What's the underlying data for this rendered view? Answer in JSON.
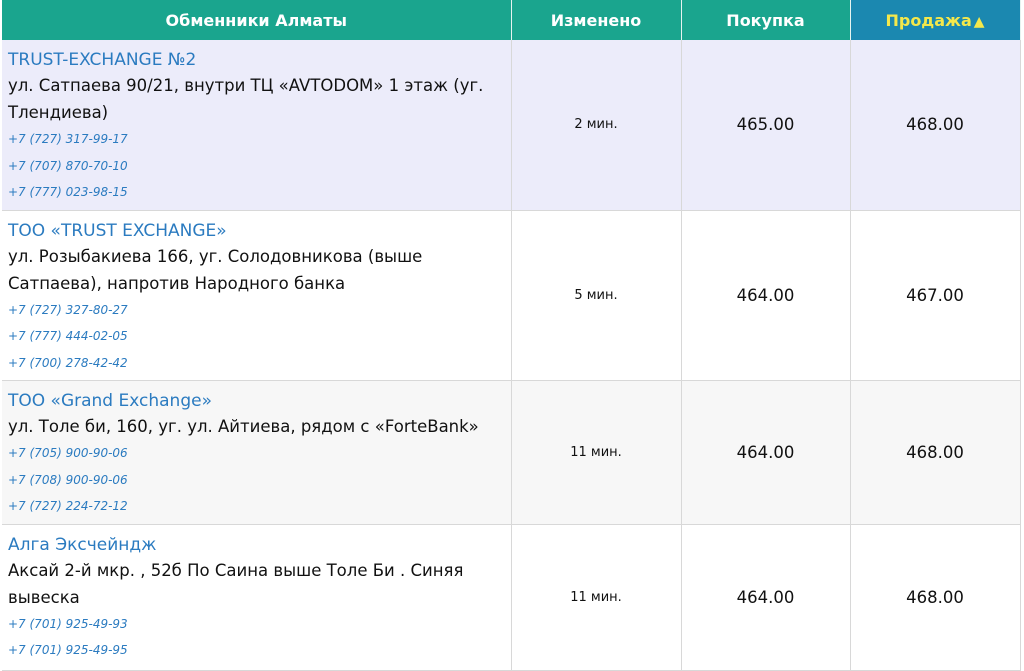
{
  "header": {
    "col_name": "Обменники Алматы",
    "col_changed": "Изменено",
    "col_buy": "Покупка",
    "col_sell": "Продажа",
    "sort_indicator": "▲"
  },
  "colors": {
    "header_bg": "#1aa58e",
    "sorted_header_bg": "#1b88b0",
    "sorted_header_text": "#f4e84b",
    "link": "#2b7bc0",
    "highlight_row": "#ececfa"
  },
  "rows": [
    {
      "name": "TRUST-EXCHANGE №2",
      "address": "ул. Сатпаева 90/21, внутри ТЦ «AVTODOM» 1 этаж (уг. Тлендиева)",
      "phones": [
        "+7 (727) 317-99-17",
        "+7 (707) 870-70-10",
        "+7 (777) 023-98-15"
      ],
      "changed": "2 мин.",
      "buy": "465.00",
      "sell": "468.00"
    },
    {
      "name": "ТОО «TRUST EXCHANGE»",
      "address": "ул. Розыбакиева 166, уг. Солодовникова (выше Сатпаева), напротив Народного банка",
      "phones": [
        "+7 (727) 327-80-27",
        "+7 (777) 444-02-05",
        "+7 (700) 278-42-42"
      ],
      "changed": "5 мин.",
      "buy": "464.00",
      "sell": "467.00"
    },
    {
      "name": "ТОО «Grand Exchange»",
      "address": "ул. Толе би, 160, уг. ул. Айтиева, рядом с «ForteBank»",
      "phones": [
        "+7 (705) 900-90-06",
        "+7 (708) 900-90-06",
        "+7 (727) 224-72-12"
      ],
      "changed": "11 мин.",
      "buy": "464.00",
      "sell": "468.00"
    },
    {
      "name": "Алга Эксчейндж",
      "address": "Аксай 2-й мкр. , 52б По Саина выше Толе Би . Синяя вывеска",
      "phones": [
        "+7 (701) 925-49-93",
        "+7 (701) 925-49-95"
      ],
      "changed": "11 мин.",
      "buy": "464.00",
      "sell": "468.00"
    }
  ]
}
